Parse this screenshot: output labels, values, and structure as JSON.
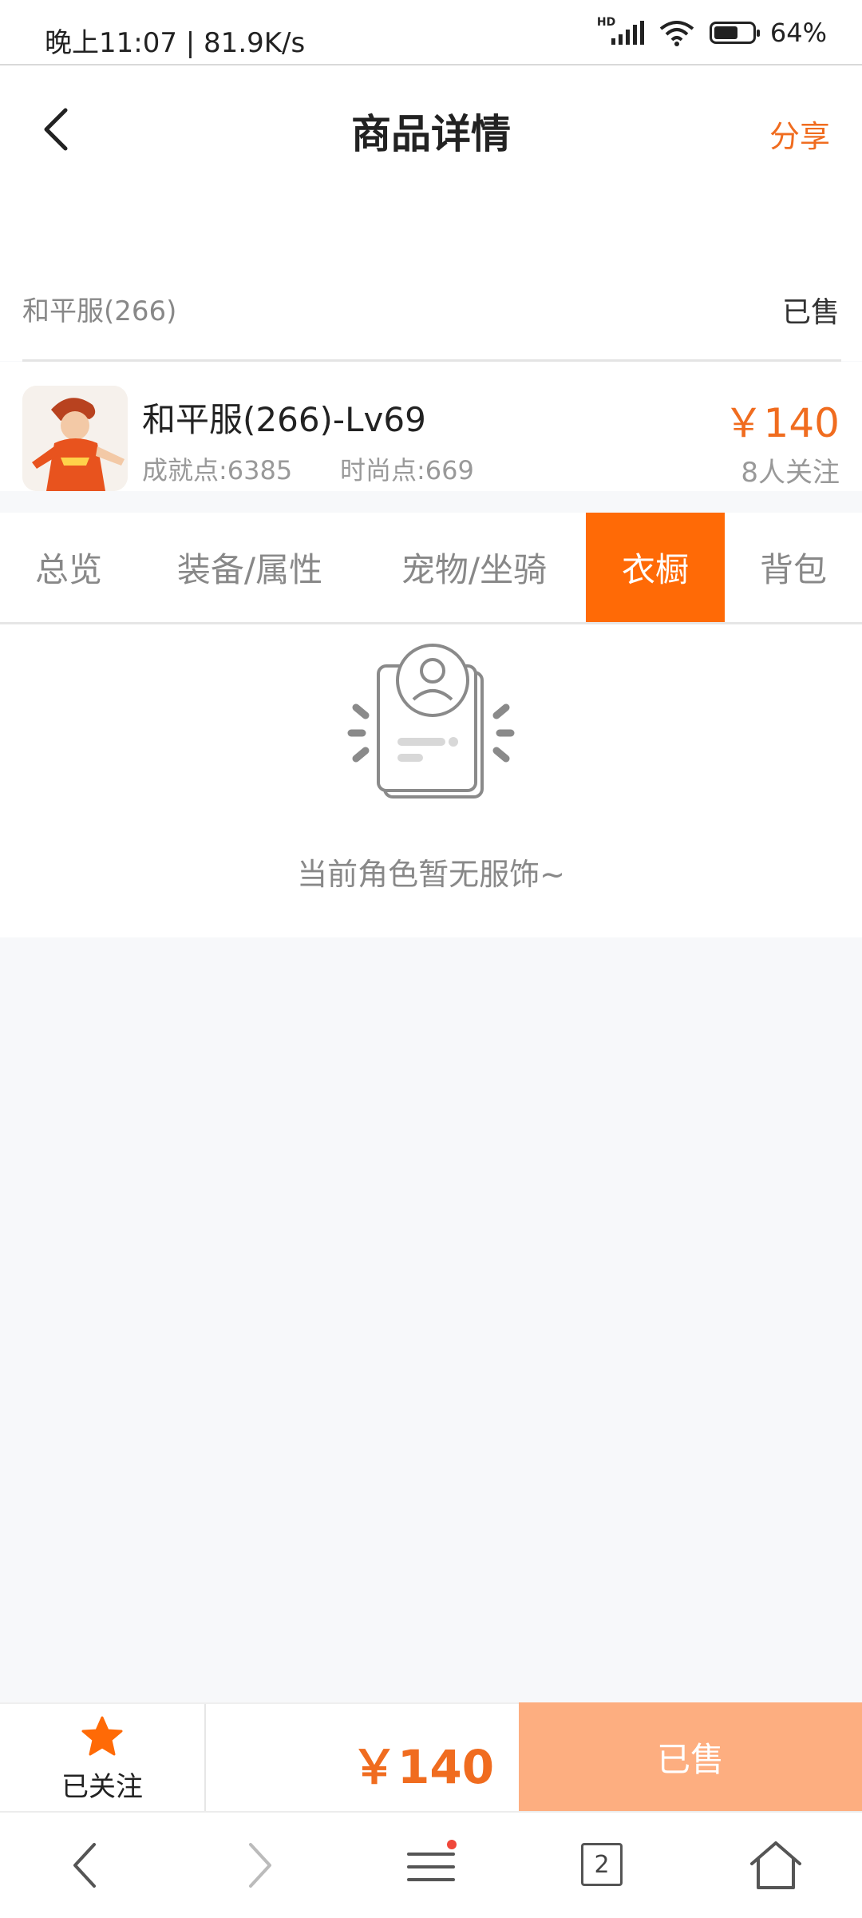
{
  "status_bar": {
    "left_text": "晚上11:07 | 81.9K/s",
    "network": "HD",
    "battery": "64%",
    "battery_level": 0.64
  },
  "header": {
    "title": "商品详情",
    "share_label": "分享",
    "back_icon": "back-arrow-icon"
  },
  "listing": {
    "server": "和平服(266)",
    "status": "已售",
    "title": "和平服(266)-Lv69",
    "achievement_points": "成就点:6385",
    "fashion_points": "时尚点:669",
    "price": "￥140",
    "followers": "8人关注"
  },
  "tabs": [
    {
      "label": "总览",
      "active": false
    },
    {
      "label": "装备/属性",
      "active": false
    },
    {
      "label": "宠物/坐骑",
      "active": false
    },
    {
      "label": "衣橱",
      "active": true
    },
    {
      "label": "背包",
      "active": false
    }
  ],
  "empty_state": {
    "message": "当前角色暂无服饰~",
    "icon": "empty-profile-icon"
  },
  "action_bar": {
    "follow_label": "已关注",
    "follow_icon": "star-icon",
    "price": "￥140",
    "sold_label": "已售"
  },
  "browser_nav": {
    "tab_count": "2",
    "icons": [
      "back-icon",
      "forward-icon",
      "menu-icon",
      "tabs-icon",
      "home-icon"
    ]
  },
  "colors": {
    "accent": "#ff6a06",
    "price": "#f06c1f",
    "sold_button": "#fdae80"
  }
}
